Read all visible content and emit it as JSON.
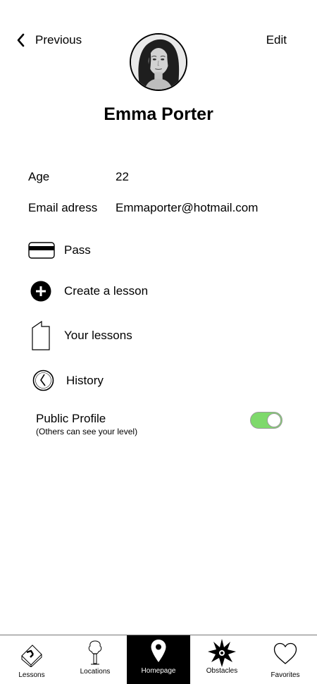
{
  "header": {
    "back_label": "Previous",
    "edit_label": "Edit"
  },
  "profile": {
    "name": "Emma Porter",
    "avatar_icon": "profile-photo"
  },
  "info": {
    "age_label": "Age",
    "age_value": "22",
    "email_label": "Email adress",
    "email_value": "Emmaporter@hotmail.com"
  },
  "menu": {
    "pass": {
      "label": "Pass",
      "icon": "credit-card-icon"
    },
    "create": {
      "label": "Create a lesson",
      "icon": "plus-circle-icon"
    },
    "lessons": {
      "label": "Your lessons",
      "icon": "document-icon"
    },
    "history": {
      "label": "History",
      "icon": "clock-icon"
    }
  },
  "public_profile": {
    "title": "Public Profile",
    "subtitle": "(Others can see your level)",
    "enabled": true,
    "toggle_color": "#7ed96b"
  },
  "tabbar": {
    "lessons": {
      "label": "Lessons",
      "icon": "parkour-box-icon"
    },
    "locations": {
      "label": "Locations",
      "icon": "tree-icon"
    },
    "homepage": {
      "label": "Homepage",
      "icon": "map-pin-icon",
      "active": true
    },
    "obstacles": {
      "label": "Obstacles",
      "icon": "spiky-obstacle-icon"
    },
    "favorites": {
      "label": "Favorites",
      "icon": "heart-icon"
    }
  }
}
